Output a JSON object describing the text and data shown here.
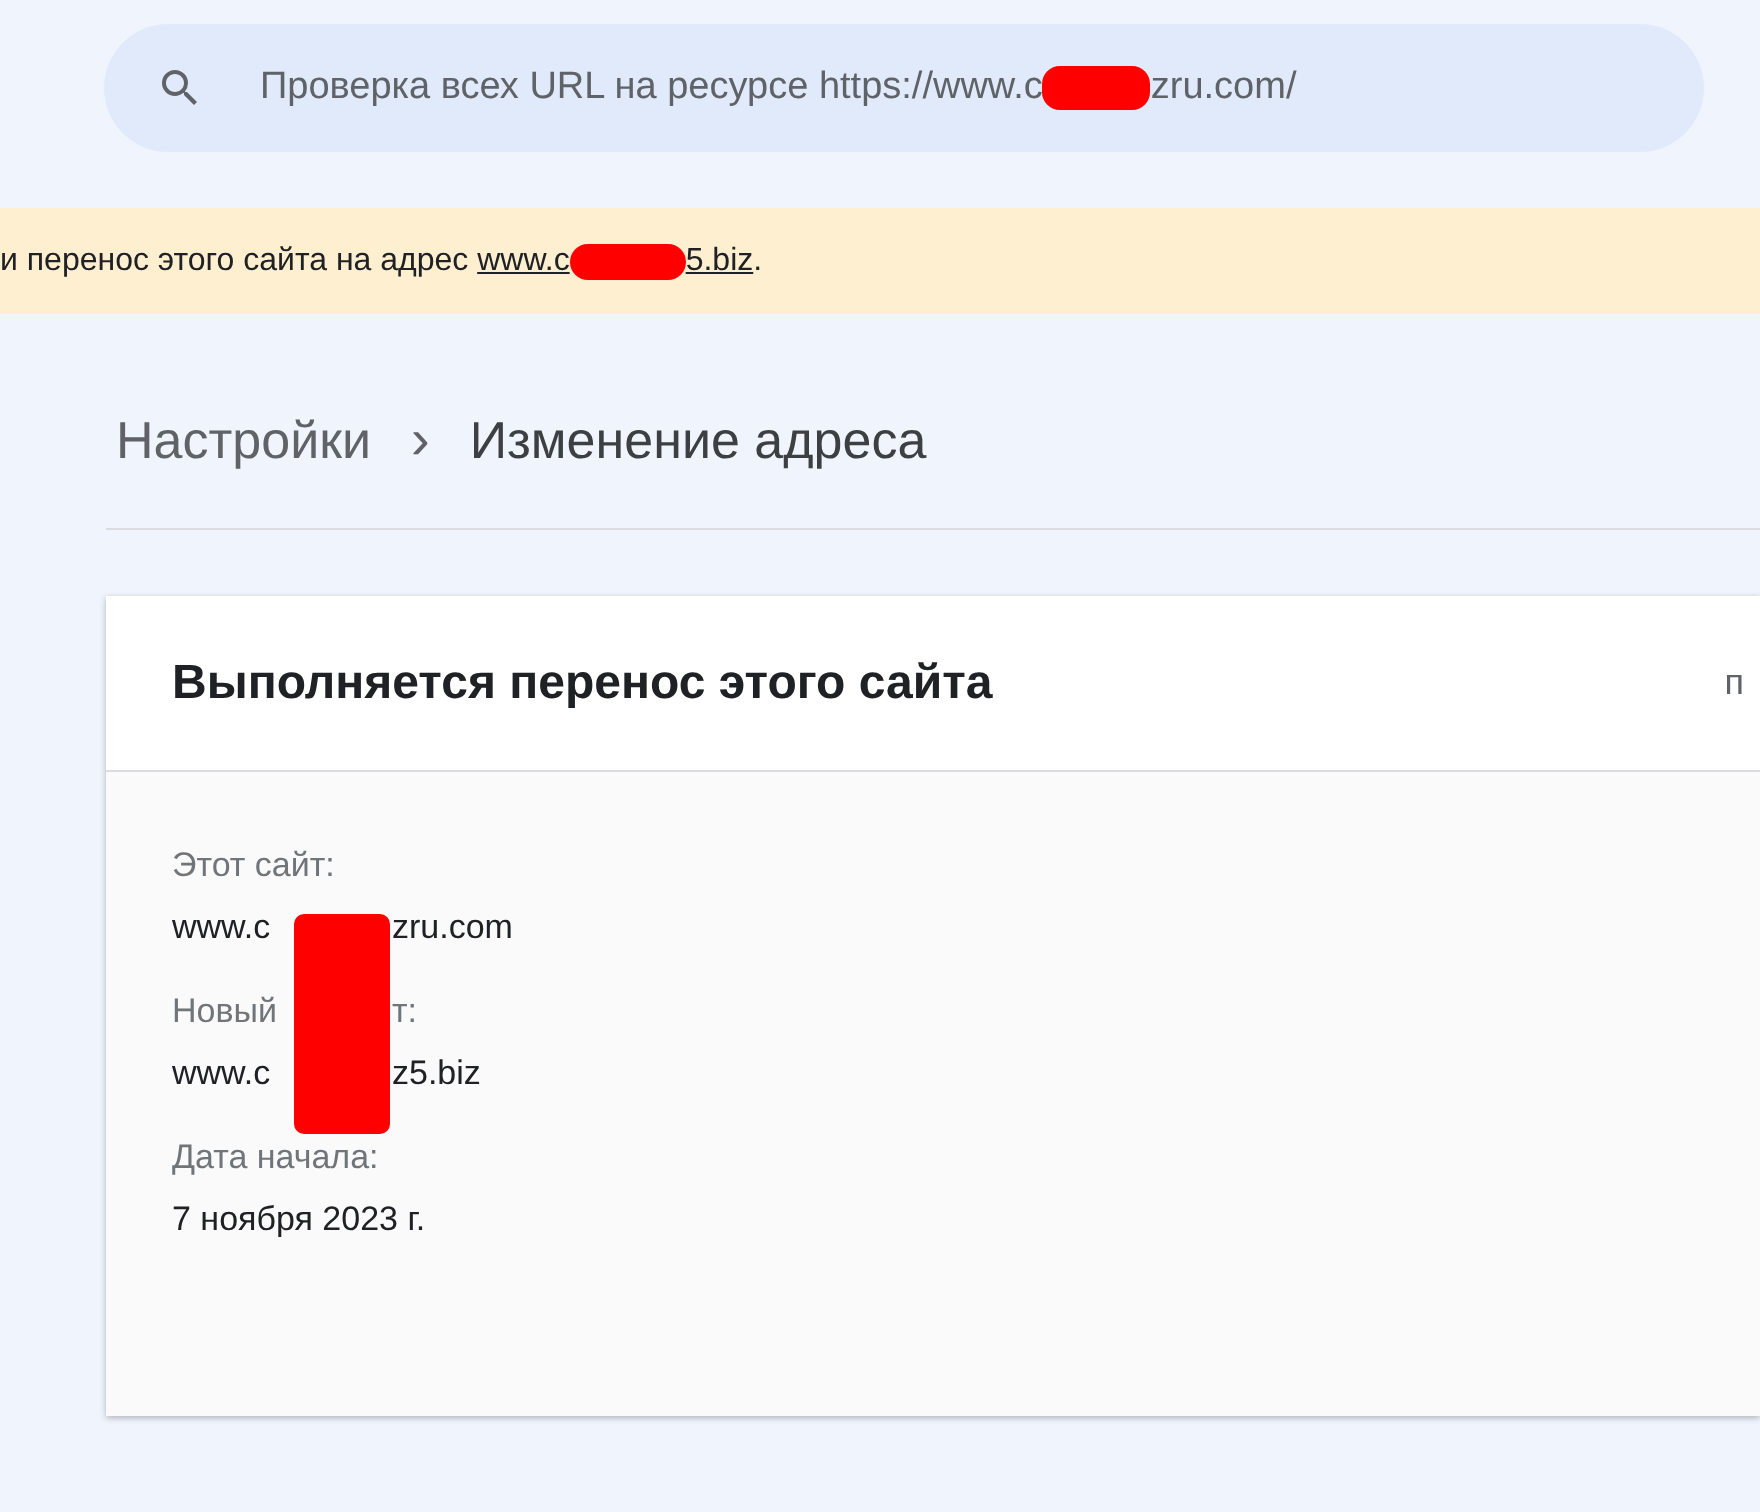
{
  "search": {
    "placeholder_parts": [
      "Проверка всех URL на ресурсе https://www.c",
      "zru.com/"
    ]
  },
  "banner": {
    "text": "и перенос этого сайта на адрес ",
    "link_parts": [
      "www.c",
      "5.biz"
    ],
    "end": "."
  },
  "breadcrumb": [
    {
      "label": "Настройки",
      "current": false
    },
    {
      "label": "Изменение адреса",
      "current": true
    }
  ],
  "breadcrumb_separator": "›",
  "card": {
    "title": "Выполняется перенос этого сайта",
    "header_right": "п",
    "fields": [
      {
        "label_parts": [
          "Этот сайт:"
        ],
        "value_parts": [
          "www.c",
          "zru.com"
        ]
      },
      {
        "label_parts": [
          "Новый",
          "т:"
        ],
        "value_parts": [
          "www.c",
          "z5.biz"
        ]
      },
      {
        "label_parts": [
          "Дата начала:"
        ],
        "value_parts": [
          "7 ноября 2023 г."
        ]
      }
    ]
  }
}
